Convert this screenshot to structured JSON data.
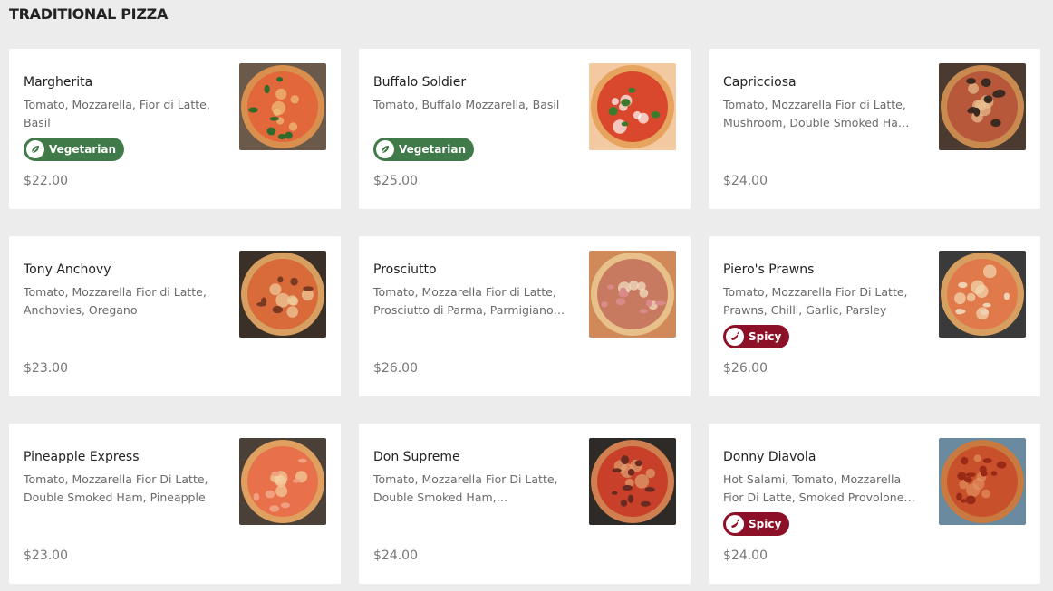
{
  "section": {
    "title": "TRADITIONAL PIZZA"
  },
  "badges": {
    "vegetarian": {
      "label": "Vegetarian",
      "color": "#3f7a48",
      "icon": "leaf-icon"
    },
    "spicy": {
      "label": "Spicy",
      "color": "#8c1128",
      "icon": "chilli-icon"
    }
  },
  "items": [
    {
      "name": "Margherita",
      "desc": "Tomato, Mozzarella, Fior di Latte, Basil",
      "badge": "vegetarian",
      "badge_label": "Vegetarian",
      "price": "$22.00",
      "image": "margherita-pizza-image"
    },
    {
      "name": "Buffalo Soldier",
      "desc": "Tomato, Buffalo Mozzarella, Basil",
      "badge": "vegetarian",
      "badge_label": "Vegetarian",
      "price": "$25.00",
      "image": "buffalo-soldier-pizza-image"
    },
    {
      "name": "Capricciosa",
      "desc": "Tomato, Mozzarella Fior di Latte, Mushroom, Double Smoked Ham, …",
      "badge": "",
      "badge_label": "",
      "price": "$24.00",
      "image": "capricciosa-pizza-image"
    },
    {
      "name": "Tony Anchovy",
      "desc": "Tomato, Mozzarella Fior di Latte, Anchovies, Oregano",
      "badge": "",
      "badge_label": "",
      "price": "$23.00",
      "image": "tony-anchovy-pizza-image"
    },
    {
      "name": "Prosciutto",
      "desc": "Tomato, Mozzarella Fior di Latte, Prosciutto di Parma, Parmigiano …",
      "badge": "",
      "badge_label": "",
      "price": "$26.00",
      "image": "prosciutto-pizza-image"
    },
    {
      "name": "Piero's Prawns",
      "desc": "Tomato, Mozzarella Fior Di Latte, Prawns, Chilli, Garlic, Parsley",
      "badge": "spicy",
      "badge_label": "Spicy",
      "price": "$26.00",
      "image": "pieros-prawns-pizza-image"
    },
    {
      "name": "Pineapple Express",
      "desc": "Tomato, Mozzarella Fior Di Latte, Double Smoked Ham, Pineapple",
      "badge": "",
      "badge_label": "",
      "price": "$23.00",
      "image": "pineapple-express-pizza-image"
    },
    {
      "name": "Don Supreme",
      "desc": "Tomato, Mozzarella Fior Di Latte, Double Smoked Ham, Mushrooms…",
      "badge": "",
      "badge_label": "",
      "price": "$24.00",
      "image": "don-supreme-pizza-image"
    },
    {
      "name": "Donny Diavola",
      "desc": "Hot Salami, Tomato, Mozzarella Fior Di Latte, Smoked Provolone, …",
      "badge": "spicy",
      "badge_label": "Spicy",
      "price": "$24.00",
      "image": "donny-diavola-pizza-image"
    }
  ]
}
